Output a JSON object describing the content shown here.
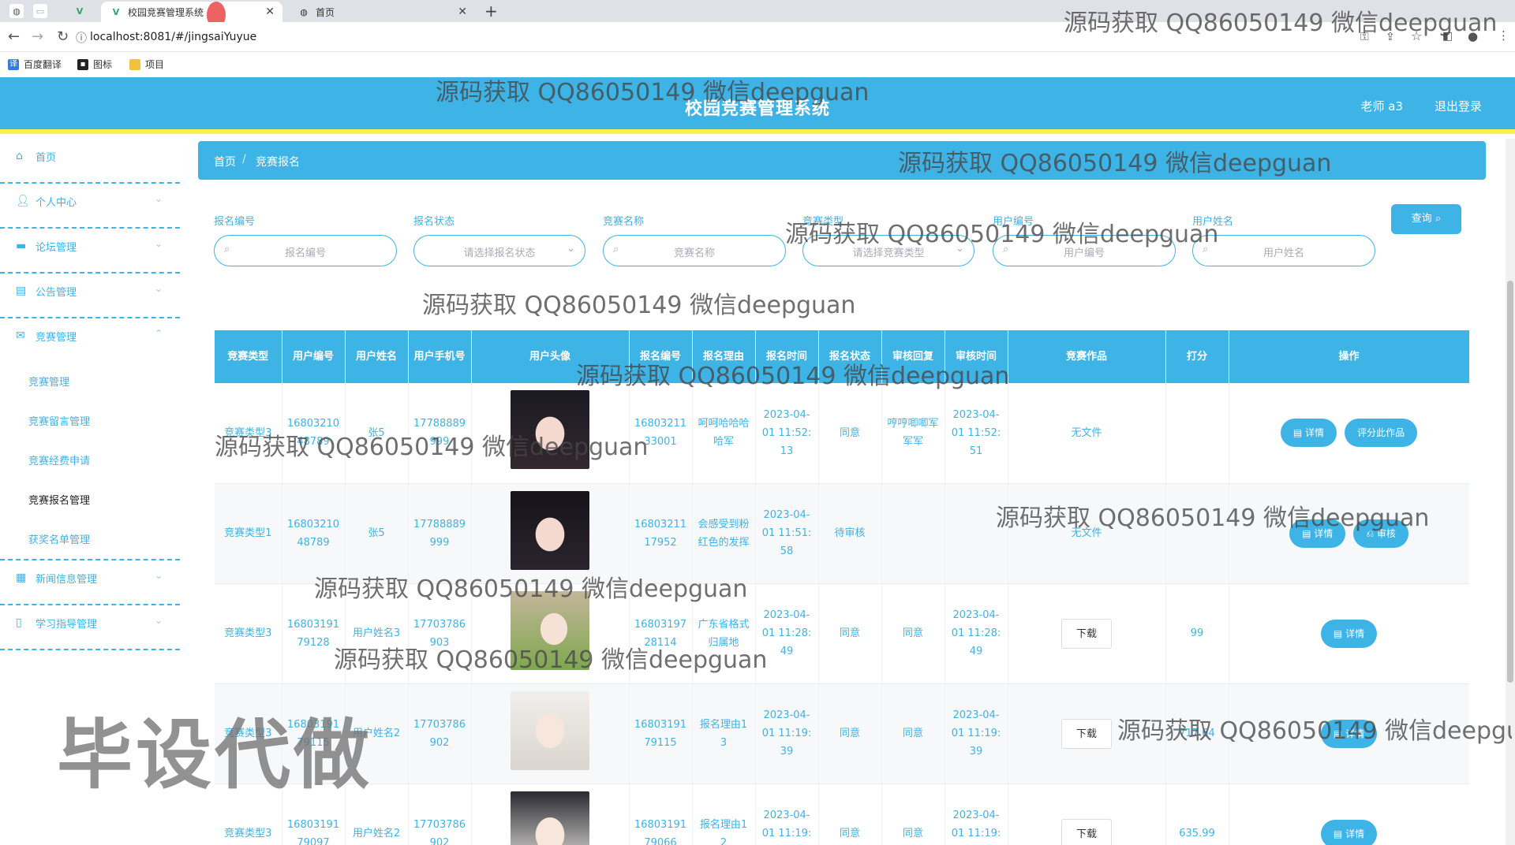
{
  "browser": {
    "active_tab_title": "校园竞赛管理系统",
    "second_tab_title": "首页",
    "url": "localhost:8081/#/jingsaiYuyue",
    "bookmarks": [
      "百度翻译",
      "图标",
      "项目"
    ]
  },
  "header": {
    "title": "校园竞赛管理系统",
    "user": "老师 a3",
    "logout": "退出登录"
  },
  "sidebar": {
    "menus": [
      {
        "label": "首页"
      },
      {
        "label": "个人中心"
      },
      {
        "label": "论坛管理"
      },
      {
        "label": "公告管理"
      },
      {
        "label": "竞赛管理"
      }
    ],
    "submenus": [
      "竞赛管理",
      "竞赛留言管理",
      "竞赛经费申请",
      "竞赛报名管理",
      "获奖名单管理"
    ],
    "menus_after": [
      {
        "label": "新闻信息管理"
      },
      {
        "label": "学习指导管理"
      }
    ]
  },
  "breadcrumb": {
    "home": "首页",
    "sep": "/",
    "current": "竞赛报名"
  },
  "filters": {
    "labels": [
      "报名编号",
      "报名状态",
      "竞赛名称",
      "竞赛类型",
      "用户编号",
      "用户姓名"
    ],
    "placeholders": [
      "报名编号",
      "请选择报名状态",
      "竞赛名称",
      "请选择竞赛类型",
      "用户编号",
      "用户姓名"
    ],
    "query": "查询"
  },
  "table": {
    "headers": [
      "竞赛类型",
      "用户编号",
      "用户姓名",
      "用户手机号",
      "用户头像",
      "报名编号",
      "报名理由",
      "报名时间",
      "报名状态",
      "审核回复",
      "审核时间",
      "竞赛作品",
      "打分",
      "操作"
    ],
    "rows": [
      {
        "type": "竞赛类型3",
        "uid": "1680321048789",
        "name": "张5",
        "phone": "17788889999",
        "regno": "1680321133001",
        "reason": "呵呵哈哈哈哈军",
        "time": "2023-04-01 11:52:13",
        "status": "同意",
        "reply": "哼哼唧唧军军军",
        "audit_time": "2023-04-01 11:52:51",
        "work": "无文件",
        "score": "",
        "ops": [
          "详情",
          "评分此作品"
        ]
      },
      {
        "type": "竞赛类型1",
        "uid": "1680321048789",
        "name": "张5",
        "phone": "17788889999",
        "regno": "1680321117952",
        "reason": "会感受到粉红色的发挥",
        "time": "2023-04-01 11:51:58",
        "status": "待审核",
        "reply": "",
        "audit_time": "",
        "work": "无文件",
        "score": "",
        "ops": [
          "详情",
          "审核"
        ]
      },
      {
        "type": "竞赛类型3",
        "uid": "1680319179128",
        "name": "用户姓名3",
        "phone": "17703786903",
        "regno": "1680319728114",
        "reason": "广东省格式归属地",
        "time": "2023-04-01 11:28:49",
        "status": "同意",
        "reply": "同意",
        "audit_time": "2023-04-01 11:28:49",
        "work": "下载",
        "score": "99",
        "ops": [
          "详情"
        ]
      },
      {
        "type": "竞赛类型3",
        "uid": "1680319179115",
        "name": "用户姓名2",
        "phone": "17703786902",
        "regno": "1680319179115",
        "reason": "报名理由13",
        "time": "2023-04-01 11:19:39",
        "status": "同意",
        "reply": "同意",
        "audit_time": "2023-04-01 11:19:39",
        "work": "下载",
        "score": "717.64",
        "ops": [
          "详情"
        ]
      },
      {
        "type": "竞赛类型3",
        "uid": "1680319179097",
        "name": "用户姓名2",
        "phone": "17703786902",
        "regno": "1680319179066",
        "reason": "报名理由12",
        "time": "2023-04-01 11:19:39",
        "status": "同意",
        "reply": "同意",
        "audit_time": "2023-04-01 11:19:39",
        "work": "下载",
        "score": "635.99",
        "ops": [
          "详情"
        ]
      }
    ]
  },
  "watermark": {
    "text": "源码获取 QQ86050149 微信deepguan",
    "big": "毕设代做"
  }
}
